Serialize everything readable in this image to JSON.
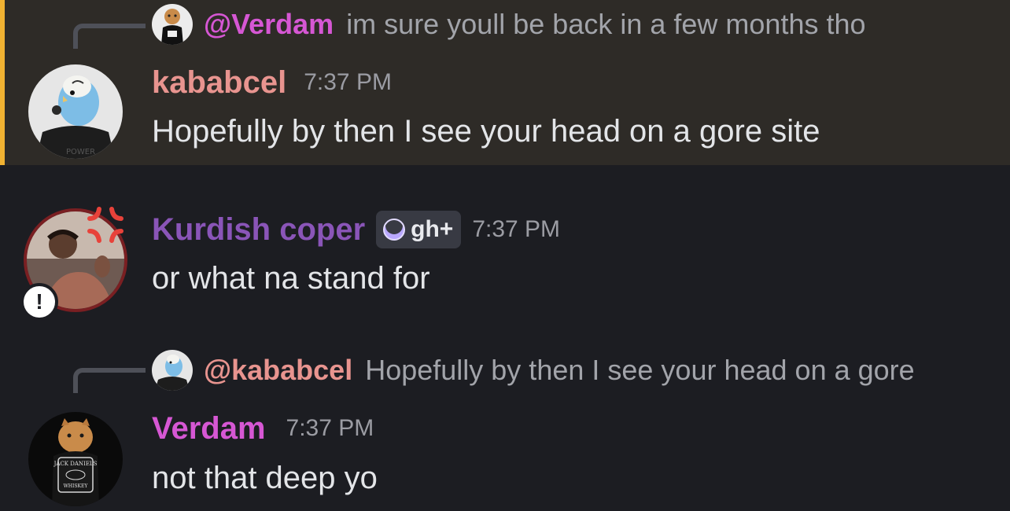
{
  "colors": {
    "background": "#1c1d22",
    "highlight_background": "#2e2b27",
    "highlight_bar": "#f0b232",
    "kababcel": "#e8948f",
    "kurdish_coper": "#8a55b8",
    "verdam": "#d657d4",
    "timestamp": "#9b9ca3",
    "message_text": "#e3e5e8"
  },
  "messages": [
    {
      "reply": {
        "avatar_icon": "cat-avatar-icon",
        "mention": "@Verdam",
        "text": "im sure youll be back in a few months tho"
      },
      "avatar_icon": "parakeet-avatar-icon",
      "username": "kababcel",
      "time": "7:37 PM",
      "content": "Hopefully by then I see your head on a gore site"
    },
    {
      "avatar_icon": "person-avatar-icon",
      "avatar_decoration": "anger-symbol-icon",
      "status_badge": "!",
      "username": "Kurdish coper",
      "tag": {
        "icon": "moon-icon",
        "label": "gh+"
      },
      "time": "7:37 PM",
      "content": "or what na stand for"
    },
    {
      "reply": {
        "avatar_icon": "parakeet-avatar-icon",
        "mention": "@kababcel",
        "text": "Hopefully by then I see your head on a gore"
      },
      "avatar_icon": "cat-avatar-icon",
      "username": "Verdam",
      "time": "7:37 PM",
      "content": "not that deep yo"
    }
  ]
}
